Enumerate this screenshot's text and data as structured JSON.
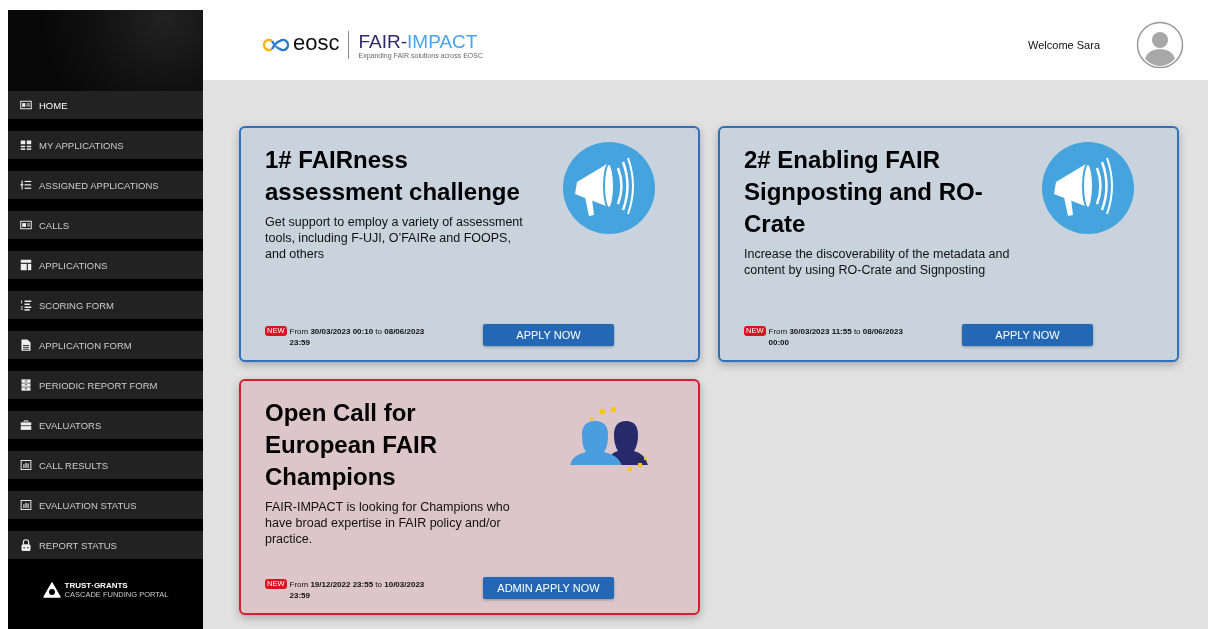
{
  "sidebar": {
    "items": [
      {
        "label": "HOME",
        "selected": true
      },
      {
        "label": "MY APPLICATIONS",
        "selected": false
      },
      {
        "label": "ASSIGNED APPLICATIONS",
        "selected": false
      },
      {
        "label": "CALLS",
        "selected": false
      },
      {
        "label": "APPLICATIONS",
        "selected": false
      },
      {
        "label": "SCORING FORM",
        "selected": false
      },
      {
        "label": "APPLICATION FORM",
        "selected": false
      },
      {
        "label": "PERIODIC REPORT FORM",
        "selected": false
      },
      {
        "label": "EVALUATORS",
        "selected": false
      },
      {
        "label": "CALL RESULTS",
        "selected": false
      },
      {
        "label": "EVALUATION STATUS",
        "selected": false
      },
      {
        "label": "REPORT STATUS",
        "selected": false
      }
    ],
    "logo": {
      "name": "TRUST·GRANTS",
      "tagline": "CASCADE FUNDING PORTAL"
    }
  },
  "header": {
    "logo": {
      "eosc": "eosc",
      "name_dark": "FAIR-",
      "name_light": "IMPACT",
      "tagline": "Expanding FAIR solutions across EOSC"
    },
    "welcome": "Welcome Sara"
  },
  "cards": [
    {
      "kind": "call",
      "title": "1# FAIRness assessment challenge",
      "description": "Get support to employ a variety of assessment tools, including F-UJI, O’FAIRe and FOOPS, and others",
      "badge": "NEW",
      "dates": "From **30/03/2023 00:10** to **08/06/2023 23:59**",
      "button": "APPLY NOW"
    },
    {
      "kind": "call",
      "title": "2# Enabling FAIR Signposting and RO-Crate",
      "description": "Increase the discoverability of the metadata and content by using RO-Crate and Signposting",
      "badge": "NEW",
      "dates": "From **30/03/2023 11:55** to **08/06/2023 00:00**",
      "button": "APPLY NOW"
    },
    {
      "kind": "admin",
      "title": "Open Call for European FAIR Champions",
      "description": "FAIR-IMPACT is looking for Champions who have broad expertise in FAIR policy and/or practice.",
      "badge": "NEW",
      "dates": "From **19/12/2022 23:55** to **10/03/2023 23:59**",
      "button": "ADMIN APPLY NOW"
    }
  ]
}
